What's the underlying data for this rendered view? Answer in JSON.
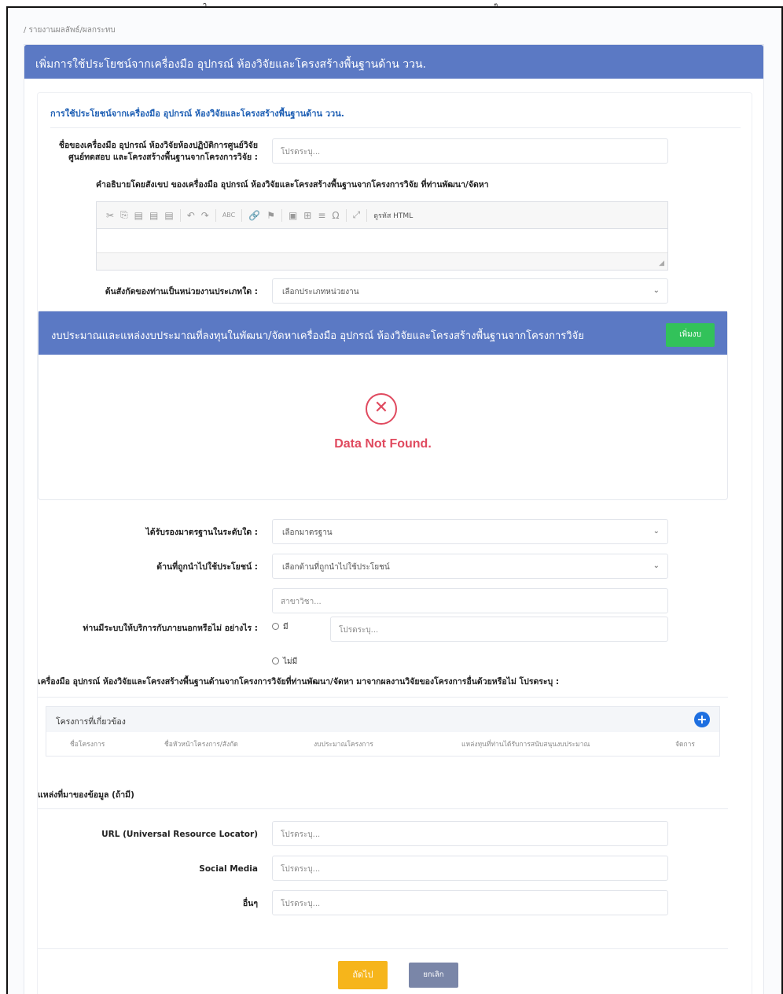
{
  "top_marks": [
    "ๅ",
    "ๆ"
  ],
  "breadcrumb": "/ รายงานผลลัพธ์/ผลกระทบ",
  "panel_title": "เพิ่มการใช้ประโยชน์จากเครื่องมือ อุปกรณ์ ห้องวิจัยและโครงสร้างพื้นฐานด้าน ววน.",
  "section_title": "การใช้ประโยชน์จากเครื่องมือ อุปกรณ์ ห้องวิจัยและโครงสร้างพื้นฐานด้าน ววน.",
  "equipment_name": {
    "label_line1": "ชื่อของเครื่องมือ อุปกรณ์ ห้องวิจัยห้องปฏิบัติการศูนย์วิจัย",
    "label_line2": "ศูนย์ทดสอบ และโครงสร้างพื้นฐานจากโครงการวิจัย :",
    "placeholder": "โปรดระบุ..."
  },
  "description_label": "คำอธิบายโดยสังเขป ของเครื่องมือ อุปกรณ์ ห้องวิจัยและโครงสร้างพื้นฐานจากโครงการวิจัย ที่ท่านพัฒนา/จัดหา",
  "editor_toolbar": [
    "✂",
    "⎘",
    "▤",
    "▤",
    "▤",
    "↶",
    "↷",
    "ABC",
    "🔗",
    "⚑",
    "▣",
    "⊞",
    "≡",
    "Ω",
    "⤢"
  ],
  "editor_source_label": "ดูรหัส HTML",
  "affiliation": {
    "label": "ต้นสังกัดของท่านเป็นหน่วยงานประเภทใด :",
    "value": "เลือกประเภทหน่วยงาน"
  },
  "budget": {
    "title": "งบประมาณและแหล่งงบประมาณที่ลงทุนในพัฒนา/จัดหาเครื่องมือ อุปกรณ์ ห้องวิจัยและโครงสร้างพื้นฐานจากโครงการวิจัย",
    "add_label": "เพิ่มงบ",
    "empty_text": "Data Not Found."
  },
  "standard": {
    "label": "ได้รับรองมาตรฐานในระดับใด :",
    "value": "เลือกมาตรฐาน"
  },
  "usage": {
    "label": "ด้านที่ถูกนำไปใช้ประโยชน์ :",
    "value": "เลือกด้านที่ถูกนำไปใช้ประโยชน์",
    "branch_placeholder": "สาขาวิชา..."
  },
  "service": {
    "label": "ท่านมีระบบให้บริการกับภายนอกหรือไม่ อย่างไร :",
    "yes": "มี",
    "no": "ไม่มี",
    "placeholder": "โปรดระบุ..."
  },
  "question": "เครื่องมือ อุปกรณ์ ห้องวิจัยและโครงสร้างพื้นฐานด้านจากโครงการวิจัยที่ท่านพัฒนา/จัดหา มาจากผลงานวิจัยของโครงการอื่นด้วยหรือไม่ โปรดระบุ :",
  "projects": {
    "title": "โครงการที่เกี่ยวข้อง",
    "columns": [
      "ชื่อโครงการ",
      "ชื่อหัวหน้าโครงการ/สังกัด",
      "งบประมาณโครงการ",
      "แหล่งทุนที่ท่านได้รับการสนับสนุนงบประมาณ",
      "จัดการ"
    ]
  },
  "sources": {
    "title": "แหล่งที่มาของข้อมูล (ถ้ามี)",
    "url_label": "URL (Universal Resource Locator)",
    "social_label": "Social Media",
    "other_label": "อื่นๆ",
    "placeholder": "โปรดระบุ..."
  },
  "buttons": {
    "next": "ถัดไป",
    "cancel": "ยกเลิก"
  }
}
